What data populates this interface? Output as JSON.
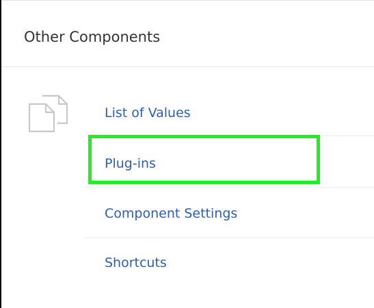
{
  "section": {
    "title": "Other Components",
    "icon": "copy-documents-icon"
  },
  "links": [
    {
      "label": "List of Values"
    },
    {
      "label": "Plug-ins",
      "highlighted": true
    },
    {
      "label": "Component Settings"
    },
    {
      "label": "Shortcuts"
    }
  ],
  "colors": {
    "link": "#2d5db6",
    "title": "#333333",
    "highlight": "#22ee22",
    "divider": "#e6e6e6"
  }
}
